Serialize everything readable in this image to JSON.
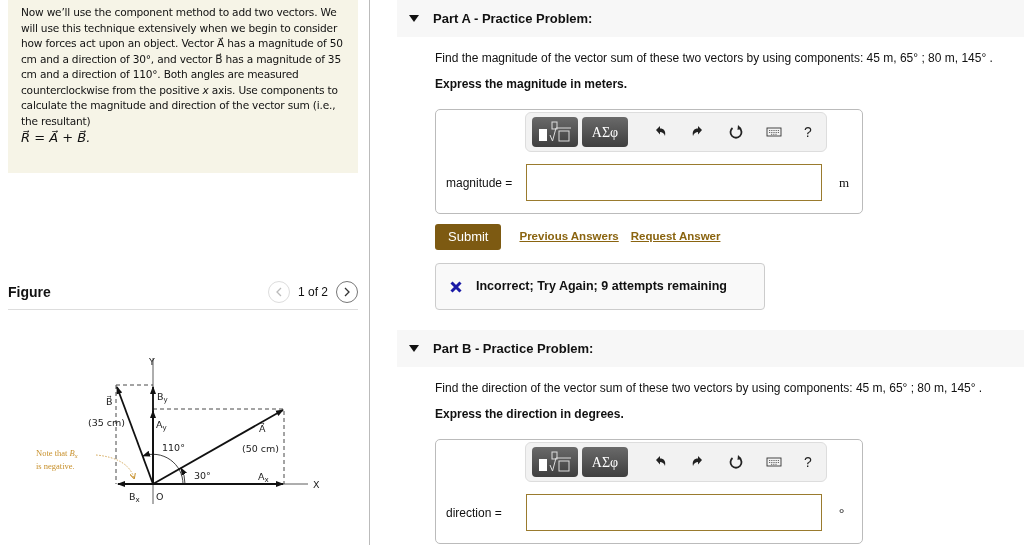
{
  "intro": {
    "text": "Now we’ll use the component method to add two vectors. We will use this technique extensively when we begin to consider how forces act upon an object. Vector A⃗ has a magnitude of 50 cm and a direction of 30°, and vector B⃗ has a magnitude of 35 cm and a direction of 110°. Both angles are measured counterclockwise from the positive *x* axis. Use components to calculate the magnitude and direction of the vector sum (i.e., the resultant)",
    "equation": "R⃗ = A⃗ + B⃗."
  },
  "figure": {
    "title": "Figure",
    "pager": "1 of 2",
    "labels": [
      "Y",
      "B$_{y}$",
      "B⃗",
      "(35 cm)",
      "A$_{y}$",
      "A⃗",
      "Note that *B$_{x}$*",
      "110°",
      "(50 cm)",
      "is negative.",
      "30°",
      "A$_{x}$",
      "B$_{x}$",
      "O",
      "X"
    ]
  },
  "parts": [
    {
      "title": "Part A - Practice Problem:",
      "expanded": true,
      "question": "Find the magnitude of the vector sum of these two vectors by using components: 45 m, 65° ; 80 m, 145° .",
      "instruction": "Express the magnitude in meters.",
      "symbols": "ΑΣφ",
      "help": "?",
      "answer_label": "magnitude =",
      "unit": "m",
      "submit": "Submit",
      "links": [
        "Previous Answers",
        "Request Answer"
      ],
      "feedback": "Incorrect; Try Again; 9 attempts remaining"
    },
    {
      "title": "Part B - Practice Problem:",
      "expanded": true,
      "question": "Find the direction of the vector sum of these two vectors by using components: 45 m, 65° ; 80 m, 145° .",
      "instruction": "Express the direction in degrees.",
      "symbols": "ΑΣφ",
      "help": "?",
      "answer_label": "direction =",
      "unit": "°"
    }
  ]
}
